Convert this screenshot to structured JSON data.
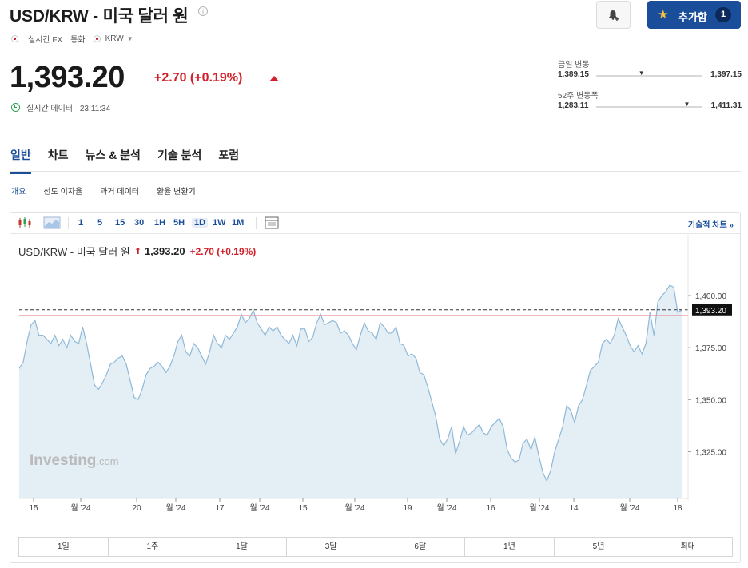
{
  "header": {
    "title": "USD/KRW - 미국 달러 원",
    "info_icon": "info-icon",
    "add_label": "추가함",
    "add_count": "1"
  },
  "meta": {
    "source": "실시간 FX",
    "type": "통화",
    "currency": "KRW"
  },
  "quote": {
    "price": "1,393.20",
    "change": "+2.70 (+0.19%)",
    "realtime_label": "실시간 데이터 · 23:11:34"
  },
  "ranges": {
    "day_label": "금일 변동",
    "day_low": "1,389.15",
    "day_high": "1,397.15",
    "day_position": 0.43,
    "week52_label": "52주 변동폭",
    "week52_low": "1,283.11",
    "week52_high": "1,411.31",
    "week52_position": 0.86
  },
  "tabs": [
    "일반",
    "차트",
    "뉴스 & 분석",
    "기술 분석",
    "포럼"
  ],
  "subtabs": [
    "개요",
    "선도 이자율",
    "과거 데이터",
    "환율 변환기"
  ],
  "toolbar": {
    "intervals": [
      "1",
      "5",
      "15",
      "30",
      "1H",
      "5H",
      "1D",
      "1W",
      "1M"
    ],
    "selected_interval": "1D",
    "tech_link": "기술적 차트 »"
  },
  "chart_header": {
    "name": "USD/KRW - 미국 달러 원",
    "price": "1,393.20",
    "change": "+2.70 (+0.19%)"
  },
  "watermark": "Investing",
  "watermark_suffix": ".com",
  "periods": [
    "1일",
    "1주",
    "1달",
    "3달",
    "6달",
    "1년",
    "5년",
    "최대"
  ],
  "chart_data": {
    "type": "area",
    "series": [
      {
        "values": [
          1365,
          1368,
          1378,
          1386,
          1388,
          1381,
          1381,
          1379,
          1377,
          1381,
          1376,
          1379,
          1375,
          1381,
          1378,
          1377,
          1385,
          1377,
          1367,
          1357,
          1355,
          1358,
          1362,
          1367,
          1368,
          1370,
          1371,
          1367,
          1359,
          1351,
          1350,
          1355,
          1362,
          1365,
          1366,
          1368,
          1366,
          1363,
          1366,
          1371,
          1378,
          1381,
          1373,
          1371,
          1377,
          1375,
          1371,
          1367,
          1373,
          1381,
          1377,
          1375,
          1381,
          1379,
          1382,
          1385,
          1391,
          1387,
          1389,
          1393,
          1387,
          1384,
          1381,
          1385,
          1383,
          1385,
          1381,
          1379,
          1377,
          1381,
          1376,
          1384,
          1384,
          1378,
          1380,
          1387,
          1391,
          1386,
          1387,
          1388,
          1387,
          1382,
          1383,
          1381,
          1377,
          1374,
          1381,
          1387,
          1383,
          1382,
          1379,
          1387,
          1385,
          1382,
          1382,
          1385,
          1377,
          1376,
          1371,
          1372,
          1370,
          1363,
          1362,
          1356,
          1349,
          1342,
          1331,
          1328,
          1331,
          1337,
          1324,
          1330,
          1337,
          1333,
          1334,
          1336,
          1338,
          1334,
          1333,
          1337,
          1339,
          1341,
          1337,
          1326,
          1322,
          1320,
          1321,
          1329,
          1331,
          1326,
          1332,
          1323,
          1315,
          1311,
          1316,
          1325,
          1331,
          1337,
          1347,
          1345,
          1339,
          1347,
          1350,
          1357,
          1364,
          1366,
          1368,
          1377,
          1379,
          1377,
          1381,
          1389,
          1385,
          1381,
          1376,
          1373,
          1376,
          1372,
          1377,
          1392,
          1381,
          1397,
          1400,
          1402,
          1405,
          1404,
          1392,
          1393
        ],
        "last": 1393.2
      }
    ],
    "x_ticks": [
      "15",
      "월 '24",
      "20",
      "월 '24",
      "17",
      "월 '24",
      "15",
      "월 '24",
      "19",
      "월 '24",
      "16",
      "월 '24",
      "14",
      "월 '24",
      "18"
    ],
    "y_ticks": [
      "1,400.00",
      "1,375.00",
      "1,350.00",
      "1,325.00"
    ],
    "y_tick_values": [
      1400,
      1375,
      1350,
      1325
    ],
    "ylim": [
      1302.5,
      1415
    ],
    "current_label": "1,393.20",
    "grid": false,
    "colors": {
      "line": "#8fb9d8",
      "fill": "#e4eef5",
      "ref": "#e8a0a8",
      "dash": "#333333",
      "price_tag": "#111111"
    }
  }
}
